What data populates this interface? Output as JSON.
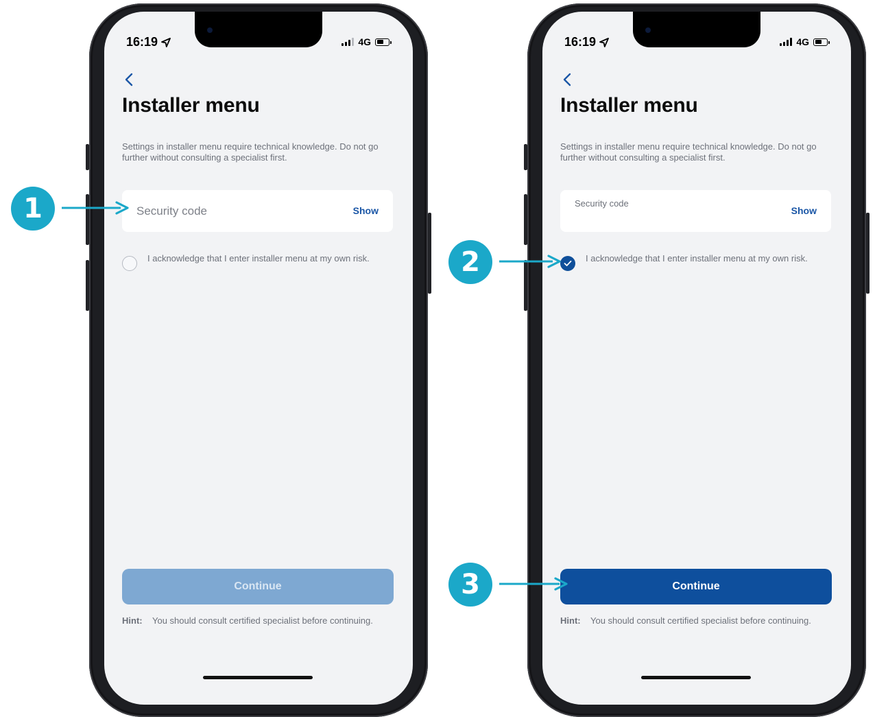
{
  "phones": [
    {
      "status": {
        "time": "16:19",
        "network": "4G"
      },
      "title": "Installer menu",
      "description": "Settings in installer menu require technical knowledge. Do not go further without consulting a specialist first.",
      "field": {
        "label": "Security code",
        "show_label": "Show"
      },
      "acknowledge": {
        "text": "I acknowledge that I enter installer menu at my own risk.",
        "checked": false
      },
      "continue_label": "Continue",
      "continue_enabled": false,
      "hint": {
        "label": "Hint:",
        "text": "You should consult certified specialist before continuing."
      }
    },
    {
      "status": {
        "time": "16:19",
        "network": "4G"
      },
      "title": "Installer menu",
      "description": "Settings in installer menu require technical knowledge. Do not go further without consulting a specialist first.",
      "field": {
        "label": "Security code",
        "show_label": "Show"
      },
      "acknowledge": {
        "text": "I acknowledge that I enter installer menu at my own risk.",
        "checked": true
      },
      "continue_label": "Continue",
      "continue_enabled": true,
      "hint": {
        "label": "Hint:",
        "text": "You should consult certified specialist before continuing."
      }
    }
  ],
  "steps": [
    "1",
    "2",
    "3"
  ],
  "colors": {
    "primary": "#0e4f9d",
    "disabled_button": "#7ea8d2",
    "link": "#1a56a6",
    "step_marker": "#1ba8c9",
    "screen_bg": "#f2f3f5"
  },
  "icons": [
    "back-chevron-icon",
    "location-arrow-icon",
    "signal-icon",
    "battery-icon",
    "checkmark-icon",
    "arrow-right-icon"
  ]
}
